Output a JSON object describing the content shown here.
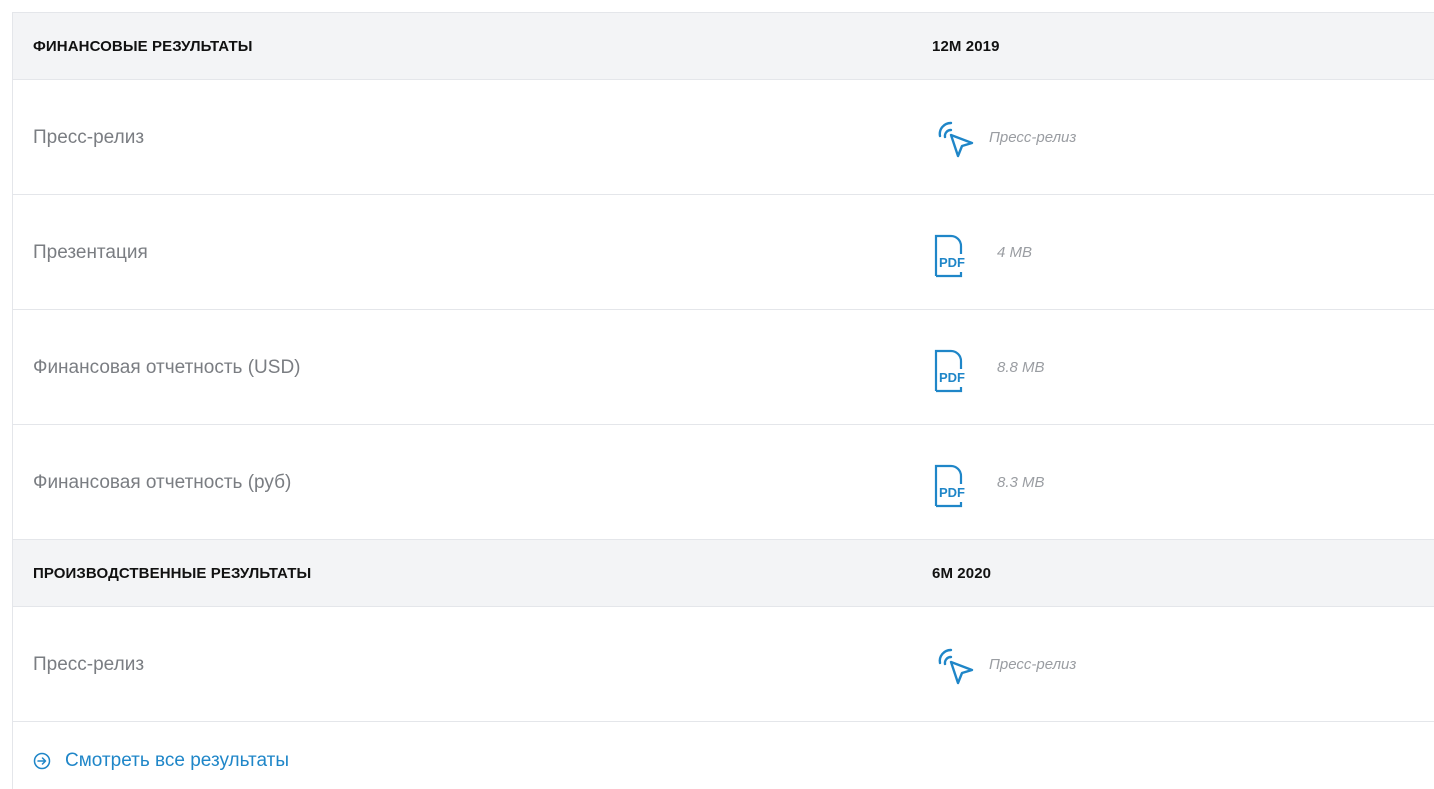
{
  "sections": [
    {
      "title": "ФИНАНСОВЫЕ РЕЗУЛЬТАТЫ",
      "period": "12M 2019",
      "items": [
        {
          "label": "Пресс-релиз",
          "icon": "cursor-icon",
          "meta": "Пресс-релиз"
        },
        {
          "label": "Презентация",
          "icon": "pdf-icon",
          "icon_text": "PDF",
          "meta": "4 MB"
        },
        {
          "label": "Финансовая отчетность (USD)",
          "icon": "pdf-icon",
          "icon_text": "PDF",
          "meta": "8.8 MB"
        },
        {
          "label": "Финансовая отчетность (руб)",
          "icon": "pdf-icon",
          "icon_text": "PDF",
          "meta": "8.3 MB"
        }
      ]
    },
    {
      "title": "ПРОИЗВОДСТВЕННЫЕ РЕЗУЛЬТАТЫ",
      "period": "6M 2020",
      "items": [
        {
          "label": "Пресс-релиз",
          "icon": "cursor-icon",
          "meta": "Пресс-релиз"
        }
      ]
    }
  ],
  "view_all": {
    "label": "Смотреть все результаты",
    "icon": "arrow-circle-right-icon"
  },
  "colors": {
    "accent": "#1f86c8",
    "header_bg": "#f3f4f6",
    "border": "#e4e6ea",
    "label": "#7a7d82"
  }
}
